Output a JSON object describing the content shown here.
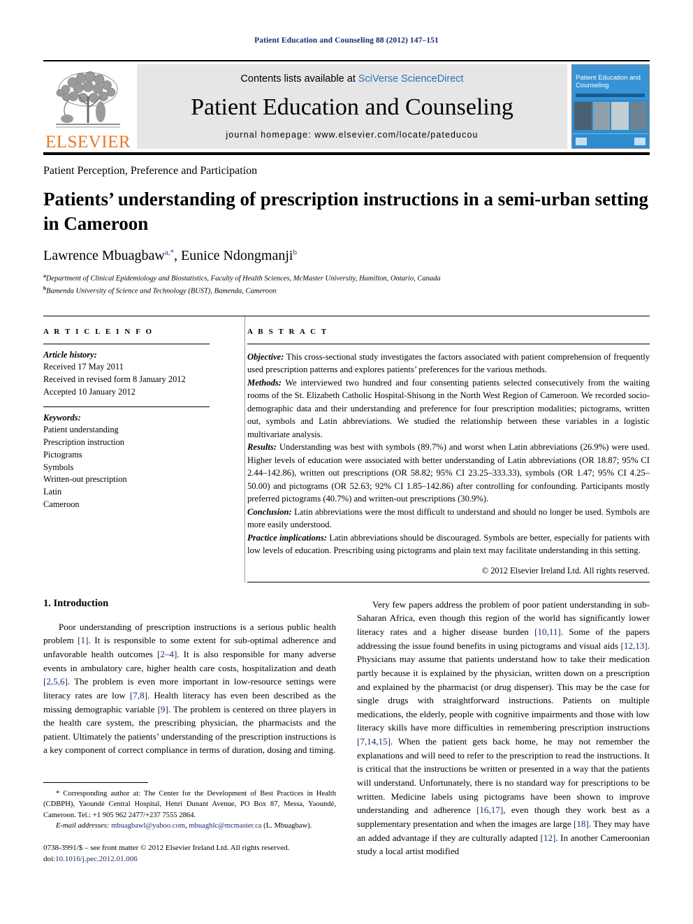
{
  "running_head": "Patient Education and Counseling 88 (2012) 147–151",
  "masthead": {
    "contents_prefix": "Contents lists available at ",
    "contents_link": "SciVerse ScienceDirect",
    "journal_title": "Patient Education and Counseling",
    "homepage": "journal homepage: www.elsevier.com/locate/pateducou",
    "publisher_wordmark": "ELSEVIER",
    "cover_title": "Patient Education and Counseling"
  },
  "section_label": "Patient Perception, Preference and Participation",
  "article": {
    "title": "Patients’ understanding of prescription instructions in a semi-urban setting in Cameroon",
    "authors_html": "Lawrence Mbuagbaw, Eunice Ndongmanji",
    "author_1": "Lawrence Mbuagbaw",
    "author_1_sup": "a,*",
    "author_2": "Eunice Ndongmanji",
    "author_2_sup": "b",
    "affiliation_a_sup": "a",
    "affiliation_a": "Department of Clinical Epidemiology and Biostatistics, Faculty of Health Sciences, McMaster University, Hamilton, Ontario, Canada",
    "affiliation_b_sup": "b",
    "affiliation_b": "Bamenda University of Science and Technology (BUST), Bamenda, Cameroon"
  },
  "article_info": {
    "heading": "A R T I C L E   I N F O",
    "history_label": "Article history:",
    "history": [
      "Received 17 May 2011",
      "Received in revised form 8 January 2012",
      "Accepted 10 January 2012"
    ],
    "keywords_label": "Keywords:",
    "keywords": [
      "Patient understanding",
      "Prescription instruction",
      "Pictograms",
      "Symbols",
      "Written-out prescription",
      "Latin",
      "Cameroon"
    ]
  },
  "abstract": {
    "heading": "A B S T R A C T",
    "objective_label": "Objective:",
    "objective_text": " This cross-sectional study investigates the factors associated with patient comprehension of frequently used prescription patterns and explores patients’ preferences for the various methods.",
    "methods_label": "Methods:",
    "methods_text": " We interviewed two hundred and four consenting patients selected consecutively from the waiting rooms of the St. Elizabeth Catholic Hospital-Shisong in the North West Region of Cameroon. We recorded socio-demographic data and their understanding and preference for four prescription modalities; pictograms, written out, symbols and Latin abbreviations. We studied the relationship between these variables in a logistic multivariate analysis.",
    "results_label": "Results:",
    "results_text": " Understanding was best with symbols (89.7%) and worst when Latin abbreviations (26.9%) were used. Higher levels of education were associated with better understanding of Latin abbreviations (OR 18.87; 95% CI 2.44–142.86), written out prescriptions (OR 58.82; 95% CI 23.25–333.33), symbols (OR 1.47; 95% CI 4.25–50.00) and pictograms (OR 52.63; 92% CI 1.85–142.86) after controlling for confounding. Participants mostly preferred pictograms (40.7%) and written-out prescriptions (30.9%).",
    "conclusion_label": "Conclusion:",
    "conclusion_text": " Latin abbreviations were the most difficult to understand and should no longer be used. Symbols are more easily understood.",
    "practice_label": "Practice implications:",
    "practice_text": " Latin abbreviations should be discouraged. Symbols are better, especially for patients with low levels of education. Prescribing using pictograms and plain text may facilitate understanding in this setting.",
    "copyright": "© 2012 Elsevier Ireland Ltd. All rights reserved."
  },
  "body": {
    "intro_heading": "1. Introduction",
    "left_para_1_a": "Poor understanding of prescription instructions is a serious public health problem ",
    "left_para_1_r1": "[1]",
    "left_para_1_b": ". It is responsible to some extent for sub-optimal adherence and unfavorable health outcomes ",
    "left_para_1_r2": "[2–4]",
    "left_para_1_c": ". It is also responsible for many adverse events in ambulatory care, higher health care costs, hospitalization and death ",
    "left_para_1_r3": "[2,5,6]",
    "left_para_1_d": ". The problem is even more important in low-resource settings were literacy rates are low ",
    "left_para_1_r4": "[7,8]",
    "left_para_1_e": ". Health literacy has even been described as the missing demographic variable ",
    "left_para_1_r5": "[9]",
    "left_para_1_f": ". The problem is centered on three players in the health care system, the prescribing physician, the pharmacists and the patient. Ultimately the patients’ understanding of the prescription instructions is a key component of correct compliance in terms of duration, dosing and timing.",
    "right_para_1_a": "Very few papers address the problem of poor patient understanding in sub-Saharan Africa, even though this region of the world has significantly lower literacy rates and a higher disease burden ",
    "right_para_1_r1": "[10,11]",
    "right_para_1_b": ". Some of the papers addressing the issue found benefits in using pictograms and visual aids ",
    "right_para_1_r2": "[12,13]",
    "right_para_1_c": ". Physicians may assume that patients understand how to take their medication partly because it is explained by the physician, written down on a prescription and explained by the pharmacist (or drug dispenser). This may be the case for single drugs with straightforward instructions. Patients on multiple medications, the elderly, people with cognitive impairments and those with low literacy skills have more difficulties in remembering prescription instructions ",
    "right_para_1_r3": "[7,14,15]",
    "right_para_1_d": ". When the patient gets back home, he may not remember the explanations and will need to refer to the prescription to read the instructions. It is critical that the instructions be written or presented in a way that the patients will understand. Unfortunately, there is no standard way for prescriptions to be written. Medicine labels using pictograms have been shown to improve understanding and adherence ",
    "right_para_1_r4": "[16,17]",
    "right_para_1_e": ", even though they work best as a supplementary presentation and when the images are large ",
    "right_para_1_r5": "[18]",
    "right_para_1_f": ". They may have an added advantage if they are culturally adapted ",
    "right_para_1_r6": "[12]",
    "right_para_1_g": ". In another Cameroonian study a local artist modified"
  },
  "footnote": {
    "star": "*",
    "corresponding_text": " Corresponding author at: The Center for the Development of Best Practices in Health (CDBPH), Yaoundé Central Hospital, Henri Dunant Avenue, PO Box 87, Messa, Yaoundé, Cameroon. Tel.: +1 905 962 2477/+237 7555 2864.",
    "email_label": "E-mail addresses:",
    "email_1": "mbuagbawl@yahoo.com",
    "email_sep": ", ",
    "email_2": "mbuagblc@mcmaster.ca",
    "email_tail": " (L. Mbuagbaw).",
    "imprint_text": "0738-3991/$ – see front matter © 2012 Elsevier Ireland Ltd. All rights reserved.",
    "doi_label": "doi:",
    "doi_value": "10.1016/j.pec.2012.01.006"
  },
  "colors": {
    "link_blue": "#2e6fb7",
    "ref_navy": "#1a2b6d",
    "elsevier_orange": "#e87722",
    "masthead_gray": "#e6e6e6"
  }
}
